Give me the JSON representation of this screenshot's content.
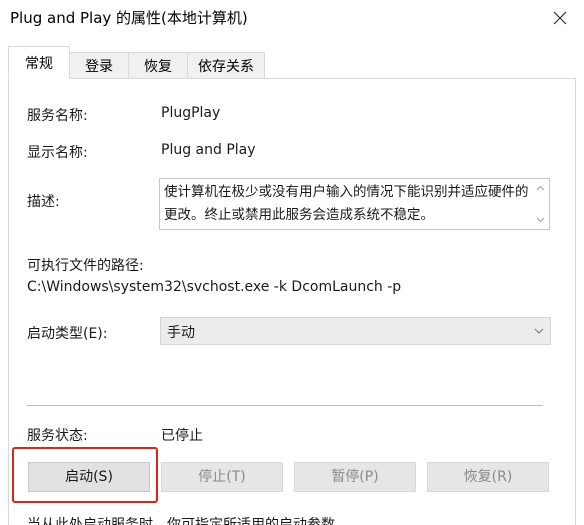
{
  "window": {
    "title": "Plug and Play 的属性(本地计算机)"
  },
  "tabs": [
    {
      "label": "常规",
      "active": true
    },
    {
      "label": "登录",
      "active": false
    },
    {
      "label": "恢复",
      "active": false
    },
    {
      "label": "依存关系",
      "active": false
    }
  ],
  "general": {
    "service_name_label": "服务名称:",
    "service_name_value": "PlugPlay",
    "display_name_label": "显示名称:",
    "display_name_value": "Plug and Play",
    "description_label": "描述:",
    "description_value": "使计算机在极少或没有用户输入的情况下能识别并适应硬件的更改。终止或禁用此服务会造成系统不稳定。",
    "exec_path_label": "可执行文件的路径:",
    "exec_path_value": "C:\\Windows\\system32\\svchost.exe -k DcomLaunch -p",
    "startup_type_label": "启动类型(E):",
    "startup_type_value": "手动",
    "service_status_label": "服务状态:",
    "service_status_value": "已停止"
  },
  "buttons": {
    "start": "启动(S)",
    "stop": "停止(T)",
    "pause": "暂停(P)",
    "resume": "恢复(R)"
  },
  "footer": {
    "hint": "当从此处启动服务时，你可指定所适用的启动参数。"
  },
  "colors": {
    "highlight": "#d9261c",
    "disabled_text": "#8a8a8a"
  },
  "icons": {
    "close": "close-icon",
    "select_arrow": "chevron-down-icon",
    "scroll_up": "chevron-up-icon",
    "scroll_down": "chevron-down-icon"
  }
}
